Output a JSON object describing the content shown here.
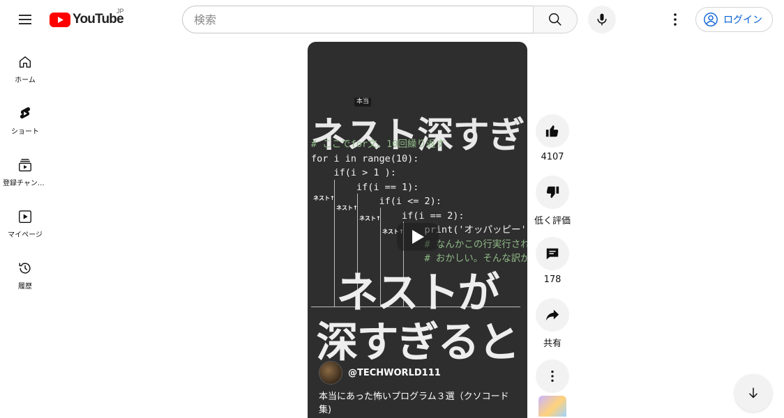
{
  "header": {
    "logo_text": "YouTube",
    "region": "JP",
    "search_placeholder": "検索",
    "login_label": "ログイン"
  },
  "sidebar": {
    "items": [
      {
        "label": "ホーム",
        "icon": "home-icon"
      },
      {
        "label": "ショート",
        "icon": "shorts-icon"
      },
      {
        "label": "登録チャンネル",
        "icon": "subscriptions-icon"
      },
      {
        "label": "マイページ",
        "icon": "you-icon"
      },
      {
        "label": "履歴",
        "icon": "history-icon"
      }
    ]
  },
  "video": {
    "overlay_top_title": "ネスト深すぎ",
    "overlay_tag": "本当",
    "code_lines": [
      "# ここでfor文。10回繰り返す",
      "for i in range(10):",
      "    if(i > 1 ):",
      "        if(i == 1):",
      "            if(i <= 2):",
      "                if(i == 2):",
      "                    print('オッパッピー')",
      "                    # なんかこの行実行され",
      "                    # おかしい。そんな訳が"
    ],
    "nest_label": "ネスト↑",
    "overlay_mid_title": "ネストが",
    "overlay_bottom_title": "深すぎると",
    "channel_name": "@TECHWORLD111",
    "title": "本当にあった怖いプログラム３選（クソコード集)"
  },
  "actions": {
    "like_count": "4107",
    "dislike_label": "低く評価",
    "comment_count": "178",
    "share_label": "共有"
  },
  "colors": {
    "accent": "#065fd4",
    "logo_red": "#ff0000",
    "player_bg": "#2e2e2e",
    "code_comment": "#8fb987"
  }
}
